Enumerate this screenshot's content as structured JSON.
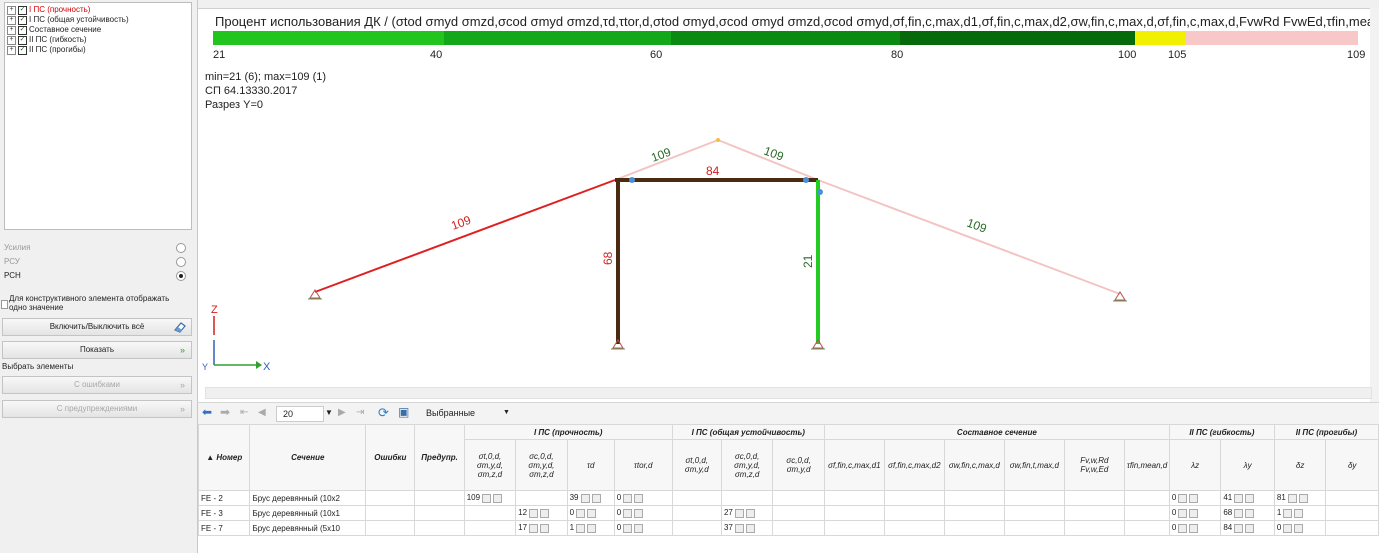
{
  "tree": {
    "items": [
      {
        "label": "I ПС (прочность)",
        "color": "#d40000"
      },
      {
        "label": "I ПС (общая устойчивость)",
        "color": "#222222"
      },
      {
        "label": "Составное сечение",
        "color": "#222222"
      },
      {
        "label": "II ПС (гибкость)",
        "color": "#222222"
      },
      {
        "label": "II ПС (прогибы)",
        "color": "#222222"
      }
    ]
  },
  "options": {
    "items": [
      {
        "label": "Усилия",
        "selected": false
      },
      {
        "label": "РСУ",
        "selected": false
      },
      {
        "label": "РСН",
        "selected": true
      }
    ]
  },
  "checkbox": {
    "label": "Для конструктивного элемента отображать одно значение"
  },
  "buttons": {
    "toggle_all": "Включить/Выключить всё",
    "show": "Показать",
    "select_header": "Выбрать элементы",
    "with_errors": "С ошибками",
    "with_warnings": "С предупреждениями"
  },
  "scale": {
    "title": "Процент использования ДК / (σtod σmyd σmzd,σcod σmyd σmzd,τd,τtor,d,σtod σmyd,σcod σmyd σmzd,σcod σmyd,σf,fin,c,max,d1,σf,fin,c,max,d2,σw,fin,c,max,d,σf,fin,c,max,d,FvwRd FvwEd,τfin,mean,d,λz,λy,Δz,Δy",
    "segments": [
      {
        "color": "#22c41e",
        "pct": 20.2
      },
      {
        "color": "#13a81a",
        "pct": 19.8
      },
      {
        "color": "#0a8a10",
        "pct": 20.0
      },
      {
        "color": "#066a0a",
        "pct": 20.5
      },
      {
        "color": "#f0f000",
        "pct": 4.5
      },
      {
        "color": "#f8c8c8",
        "pct": 15.0
      }
    ],
    "ticks": [
      "21",
      "40",
      "60",
      "80",
      "100",
      "105",
      "109"
    ]
  },
  "info": {
    "line1": "min=21 (6); max=109 (1)",
    "line2": "СП 64.13330.2017",
    "line3": "Разрез Y=0"
  },
  "model": {
    "labels": [
      "109",
      "109",
      "84",
      "109",
      "109",
      "68",
      "21"
    ],
    "axis_z": "Z",
    "axis_x": "X",
    "axis_y": "Y"
  },
  "toolbar": {
    "page_size": "20",
    "filter": "Выбранные"
  },
  "table": {
    "group_headers": [
      "I ПС (прочность)",
      "I ПС (общая устойчивость)",
      "Составное сечение",
      "II ПС (гибкость)",
      "II ПС (прогибы)"
    ],
    "col_headers": [
      "▲ Номер",
      "Сечение",
      "Ошибки",
      "Предупр."
    ],
    "sub_headers": [
      "σt,0,d, σm,y,d, σm,z,d",
      "σc,0,d, σm,y,d, σm,z,d",
      "τd",
      "τtor,d",
      "σt,0,d, σm,y,d",
      "σc,0,d, σm,y,d, σm,z,d",
      "σc,0,d, σm,y,d",
      "σf,fin,c,max,d1",
      "σf,fin,c,max,d2",
      "σw,fin,c,max,d",
      "σw,fin,t,max,d",
      "Fv,w,Rd Fv,w,Ed",
      "τfin,mean,d",
      "λz",
      "λy",
      "δz",
      "δy"
    ],
    "rows": [
      {
        "id": "FE - 2",
        "section": "Брус деревянный (10x2",
        "c1": "109",
        "c2": "",
        "c3": "39",
        "c4": "0",
        "c6": "",
        "l1": "0",
        "l2": "41",
        "d1": "81"
      },
      {
        "id": "FE - 3",
        "section": "Брус деревянный (10x1",
        "c1": "",
        "c2": "12",
        "c3": "0",
        "c4": "0",
        "c6": "27",
        "l1": "0",
        "l2": "68",
        "d1": "1"
      },
      {
        "id": "FE - 7",
        "section": "Брус деревянный (5x10",
        "c1": "",
        "c2": "17",
        "c3": "1",
        "c4": "0",
        "c6": "37",
        "l1": "0",
        "l2": "84",
        "d1": "0"
      }
    ]
  }
}
